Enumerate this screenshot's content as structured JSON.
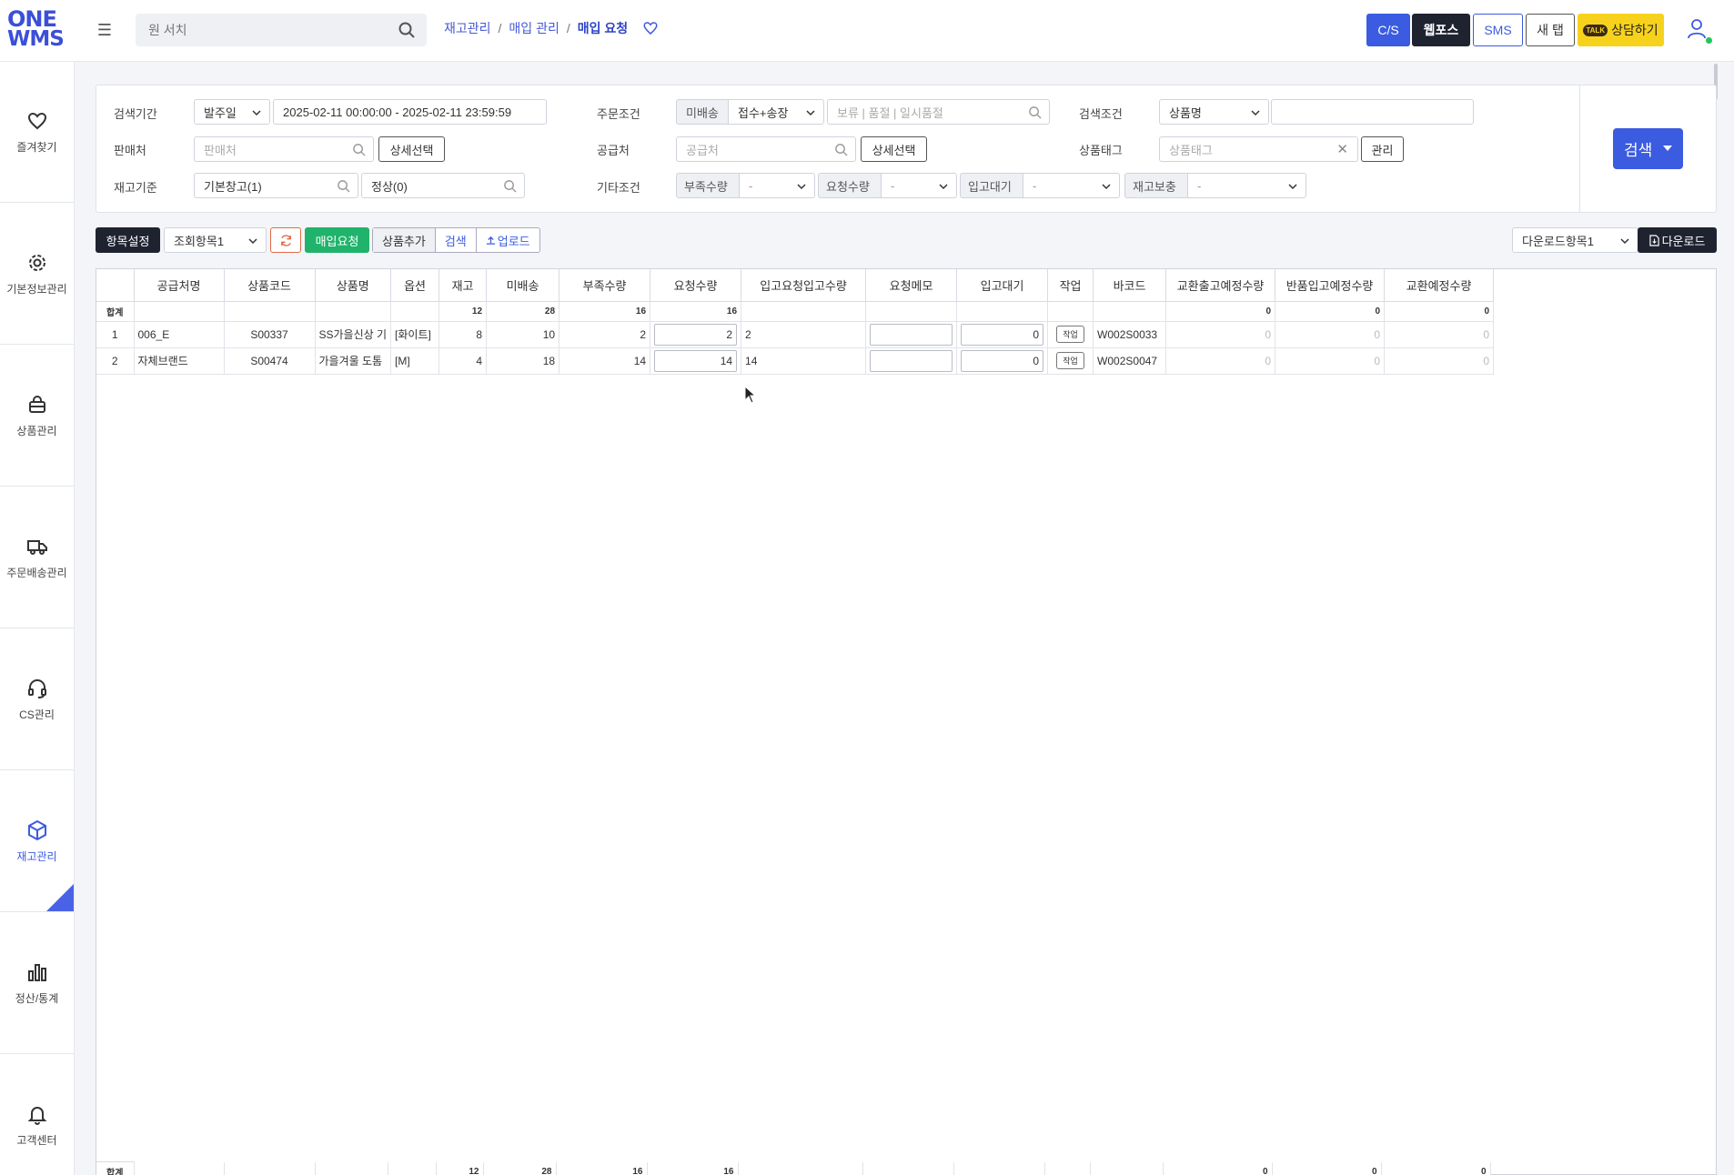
{
  "header": {
    "logo_line1": "ONE",
    "logo_line2": "WMS",
    "search_placeholder": "원 서치",
    "breadcrumb": [
      "재고관리",
      "매입 관리",
      "매입 요청"
    ],
    "buttons": {
      "cs": "C/S",
      "webpos": "웹포스",
      "sms": "SMS",
      "newtab": "새 탭",
      "talk": "상담하기",
      "talk_badge": "TALK"
    }
  },
  "sidebar": {
    "items": [
      {
        "label": "즐겨찾기",
        "icon": "heart-icon"
      },
      {
        "label": "기본정보관리",
        "icon": "gear-icon"
      },
      {
        "label": "상품관리",
        "icon": "bag-icon"
      },
      {
        "label": "주문배송관리",
        "icon": "truck-icon"
      },
      {
        "label": "CS관리",
        "icon": "headset-icon"
      },
      {
        "label": "재고관리",
        "icon": "box-icon"
      },
      {
        "label": "정산/통계",
        "icon": "bar-chart-icon"
      },
      {
        "label": "고객센터",
        "icon": "bell-icon"
      }
    ],
    "active_index": 5
  },
  "filter": {
    "period_label": "검색기간",
    "period_type": "발주일",
    "period_range": "2025-02-11 00:00:00 - 2025-02-11 23:59:59",
    "order_cond_label": "주문조건",
    "order_cond_tag": "미배송",
    "order_cond_select": "접수+송장",
    "order_cond_placeholder": "보류 | 품절 | 일시품절",
    "search_cond_label": "검색조건",
    "search_cond_select": "상품명",
    "search_cond_value": "",
    "seller_label": "판매처",
    "seller_placeholder": "판매처",
    "detail_select": "상세선택",
    "supplier_label": "공급처",
    "supplier_placeholder": "공급처",
    "tag_label": "상품태그",
    "tag_placeholder": "상품태그",
    "manage": "관리",
    "stock_label": "재고기준",
    "stock_warehouse": "기본창고(1)",
    "stock_status": "정상(0)",
    "etc_label": "기타조건",
    "etc_items": [
      {
        "tag": "부족수량",
        "value": "-"
      },
      {
        "tag": "요청수량",
        "value": "-"
      },
      {
        "tag": "입고대기",
        "value": "-"
      },
      {
        "tag": "재고보충",
        "value": "-"
      }
    ],
    "search_button": "검색"
  },
  "toolbar": {
    "column_settings": "항목설정",
    "view_select": "조회항목1",
    "purchase_request": "매입요청",
    "add_product": "상품추가",
    "search": "검색",
    "upload": "업로드",
    "download_select": "다운로드항목1",
    "download": "다운로드"
  },
  "grid": {
    "columns": [
      "",
      "공급처명",
      "상품코드",
      "상품명",
      "옵션",
      "재고",
      "미배송",
      "부족수량",
      "요청수량",
      "입고요청입고수량",
      "요청메모",
      "입고대기",
      "작업",
      "바코드",
      "교환출고예정수량",
      "반품입고예정수량",
      "교환예정수량"
    ],
    "sum_label": "합계",
    "sums": {
      "stock": "12",
      "undelivered": "28",
      "shortage": "16",
      "request": "16",
      "exch_out": "0",
      "return_in": "0",
      "exch": "0"
    },
    "work_label": "작업",
    "rows": [
      {
        "no": "1",
        "supplier": "006_E",
        "code": "S00337",
        "name": "SS가을신상 기",
        "option": "[화이트]",
        "stock": "8",
        "undelivered": "10",
        "shortage": "2",
        "request": "2",
        "req_in": "2",
        "memo": "",
        "wait": "0",
        "barcode": "W002S0033",
        "exch_out": "0",
        "return_in": "0",
        "exch": "0"
      },
      {
        "no": "2",
        "supplier": "자체브랜드",
        "code": "S00474",
        "name": "가을겨울 도톰",
        "option": "[M]",
        "stock": "4",
        "undelivered": "18",
        "shortage": "14",
        "request": "14",
        "req_in": "14",
        "memo": "",
        "wait": "0",
        "barcode": "W002S0047",
        "exch_out": "0",
        "return_in": "0",
        "exch": "0"
      }
    ]
  },
  "colors": {
    "primary": "#3b5be0",
    "dark": "#1f2330",
    "green": "#20b36b",
    "talk": "#f7d21c"
  }
}
